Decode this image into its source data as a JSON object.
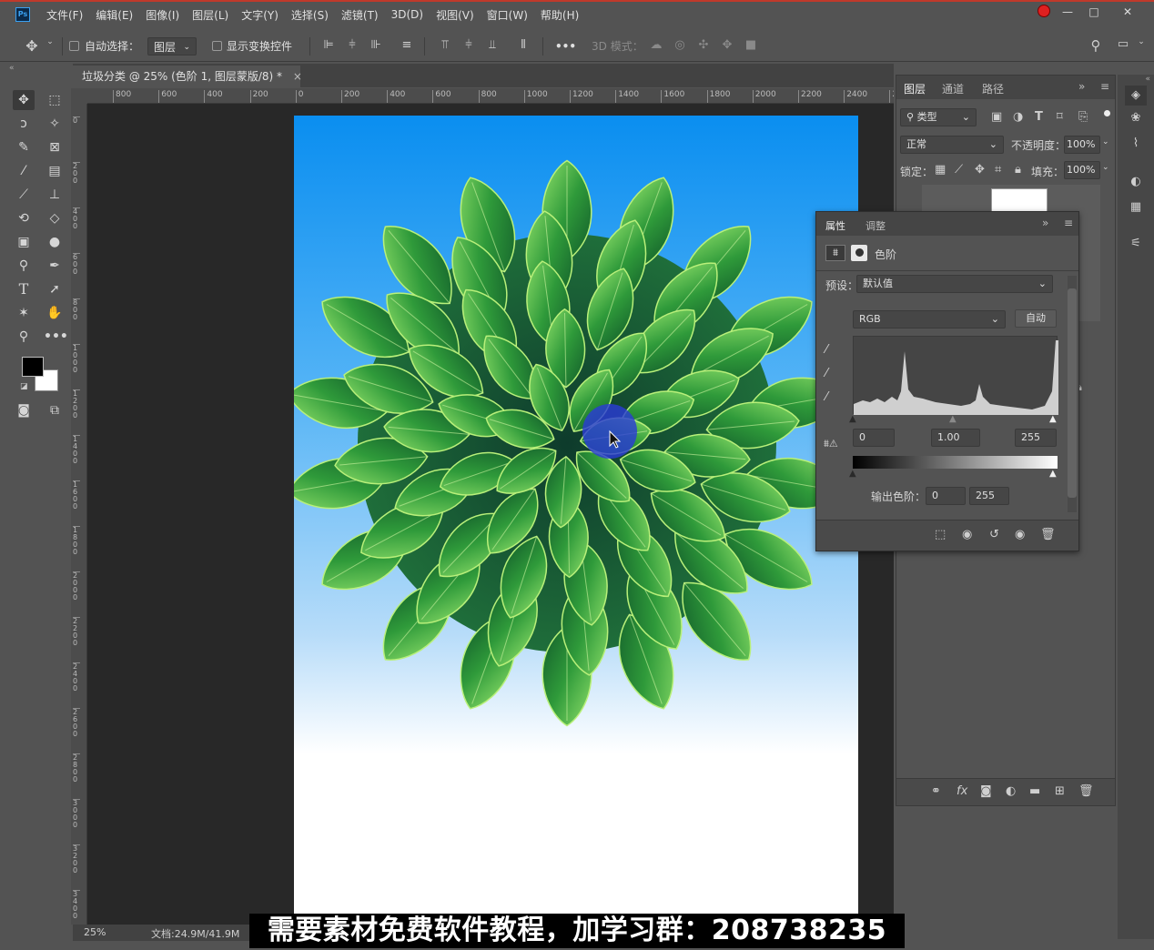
{
  "app": {
    "logo": "Ps"
  },
  "menu": [
    "文件(F)",
    "编辑(E)",
    "图像(I)",
    "图层(L)",
    "文字(Y)",
    "选择(S)",
    "滤镜(T)",
    "3D(D)",
    "视图(V)",
    "窗口(W)",
    "帮助(H)"
  ],
  "window_controls": {
    "minimize": "—",
    "restore": "□",
    "close": "✕"
  },
  "options": {
    "auto_select_label": "自动选择：",
    "auto_select_value": "图层",
    "show_transform_label": "显示变换控件",
    "mode_3d_label": "3D 模式：",
    "more": "•••"
  },
  "document": {
    "tab_title": "垃圾分类 @ 25% (色阶 1, 图层蒙版/8) *",
    "close": "×"
  },
  "ruler": {
    "h": [
      "800",
      "600",
      "400",
      "200",
      "0",
      "200",
      "400",
      "600",
      "800",
      "1000",
      "1200",
      "1400",
      "1600",
      "1800",
      "2000",
      "2200",
      "2400",
      "26"
    ],
    "v": [
      "0",
      "2 0 0",
      "4 0 0",
      "6 0 0",
      "8 0 0",
      "1 0 0 0",
      "1 2 0 0",
      "1 4 0 0",
      "1 6 0 0",
      "1 8 0 0",
      "2 0 0 0",
      "2 2 0 0",
      "2 4 0 0",
      "2 6 0 0",
      "2 8 0 0",
      "3 0 0 0",
      "3 2 0 0",
      "3 4 0 0"
    ]
  },
  "status": {
    "zoom": "25%",
    "doc": "文档:24.9M/41.9M"
  },
  "layers_panel": {
    "tabs": [
      "图层",
      "通道",
      "路径"
    ],
    "filter_label": "类型",
    "blend_mode": "正常",
    "opacity_label": "不透明度：",
    "opacity": "100%",
    "lock_label": "锁定：",
    "fill_label": "填充：",
    "fill": "100%"
  },
  "properties_panel": {
    "tabs": [
      "属性",
      "调整"
    ],
    "title": "色阶",
    "preset_label": "预设：",
    "preset_value": "默认值",
    "channel": "RGB",
    "auto_button": "自动",
    "input_black": "0",
    "input_gamma": "1.00",
    "input_white": "255",
    "output_label": "输出色阶：",
    "output_black": "0",
    "output_white": "255"
  },
  "subtitle": "需要素材免费软件教程，加学习群：208738235",
  "colors": {
    "accent_red": "#c0392b",
    "canvas_top": "#0a8ef0",
    "leaf": "#2f9a3a",
    "cursor_circle": "#2a3bd8"
  }
}
